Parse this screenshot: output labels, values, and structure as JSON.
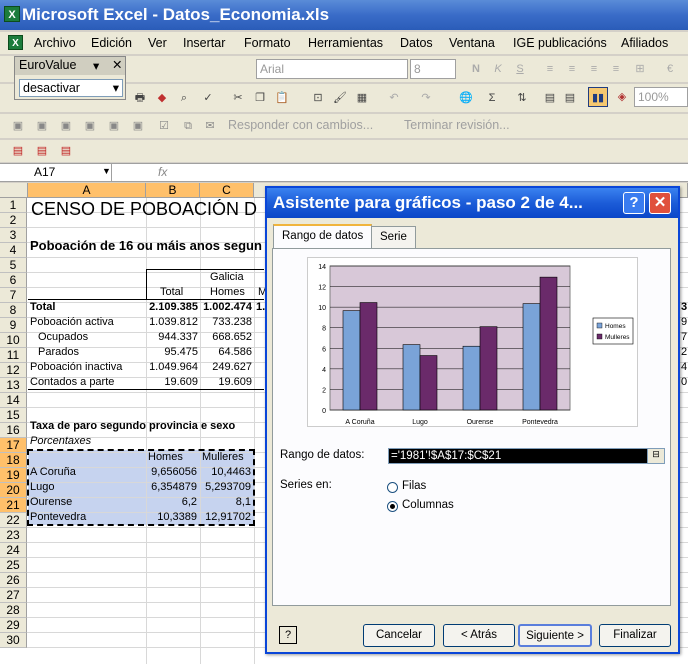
{
  "window": {
    "title": "Microsoft Excel - Datos_Economia.xls"
  },
  "menu": [
    "Archivo",
    "Edición",
    "Ver",
    "Insertar",
    "Formato",
    "Herramientas",
    "Datos",
    "Ventana",
    "IGE publicacións",
    "Afiliados"
  ],
  "eurovalue": {
    "title": "EuroValue",
    "option": "desactivar"
  },
  "toolbar": {
    "font": "Arial",
    "size": "8",
    "zoom": "100%",
    "reply_changes": "Responder con cambios...",
    "end_review": "Terminar revisión..."
  },
  "formula_bar": {
    "name_box": "A17",
    "fx": "fx"
  },
  "columns": [
    "A",
    "B",
    "C"
  ],
  "rows": [
    "1",
    "2",
    "3",
    "4",
    "5",
    "6",
    "7",
    "8",
    "9",
    "10",
    "11",
    "12",
    "13",
    "14",
    "15",
    "16",
    "17",
    "18",
    "19",
    "20",
    "21",
    "22",
    "23",
    "24",
    "25",
    "26",
    "27",
    "28",
    "29",
    "30"
  ],
  "sheet": {
    "title": "CENSO DE POBOACIÓN D",
    "subtitle": "Poboación de 16 ou máis anos segun",
    "galicia": "Galicia",
    "h_total": "Total",
    "h_homes": "Homes",
    "h_m": "M",
    "table1": [
      {
        "label": "Total",
        "total": "2.109.385",
        "homes": "1.002.474",
        "extra": "1."
      },
      {
        "label": "Poboación activa",
        "total": "1.039.812",
        "homes": "733.238"
      },
      {
        "label": "Ocupados",
        "total": "944.337",
        "homes": "668.652"
      },
      {
        "label": "Parados",
        "total": "95.475",
        "homes": "64.586"
      },
      {
        "label": "Poboación inactiva",
        "total": "1.049.964",
        "homes": "249.627"
      },
      {
        "label": "Contados a parte",
        "total": "19.609",
        "homes": "19.609"
      }
    ],
    "section2_title": "Taxa de paro segundo provincia e sexo",
    "section2_sub": "Porcentaxes",
    "t2_homes": "Homes",
    "t2_mulleres": "Mulleres",
    "table2": [
      {
        "label": "A Coruña",
        "homes": "9,656056",
        "mulleres": "10,4463"
      },
      {
        "label": "Lugo",
        "homes": "6,354879",
        "mulleres": "5,293709"
      },
      {
        "label": "Ourense",
        "homes": "6,2",
        "mulleres": "8,1"
      },
      {
        "label": "Pontevedra",
        "homes": "10,3389",
        "mulleres": "12,91702"
      }
    ],
    "right_digits": [
      "3",
      "9",
      "7",
      "2",
      "4",
      "0"
    ]
  },
  "dialog": {
    "title": "Asistente para gráficos - paso 2 de 4...",
    "tab_range": "Rango de datos",
    "tab_series": "Serie",
    "range_label": "Rango de datos:",
    "range_value": "='1981'!$A$17:$C$21",
    "series_in": "Series en:",
    "opt_rows": "Filas",
    "opt_cols": "Columnas",
    "btn_cancel": "Cancelar",
    "btn_back": "< Atrás",
    "btn_next": "Siguiente >",
    "btn_finish": "Finalizar",
    "help": "?"
  },
  "chart_data": {
    "type": "bar",
    "categories": [
      "A Coruña",
      "Lugo",
      "Ourense",
      "Pontevedra"
    ],
    "series": [
      {
        "name": "Homes",
        "values": [
          9.656056,
          6.354879,
          6.2,
          10.3389
        ],
        "color": "#7aa3d8"
      },
      {
        "name": "Mulleres",
        "values": [
          10.4463,
          5.293709,
          8.1,
          12.91702
        ],
        "color": "#6a2a6a"
      }
    ],
    "ylim": [
      0,
      14
    ],
    "yticks": [
      "0",
      "2",
      "4",
      "6",
      "8",
      "10",
      "12",
      "14"
    ],
    "legend_position": "right",
    "plot_background": "#d8c8d8"
  }
}
